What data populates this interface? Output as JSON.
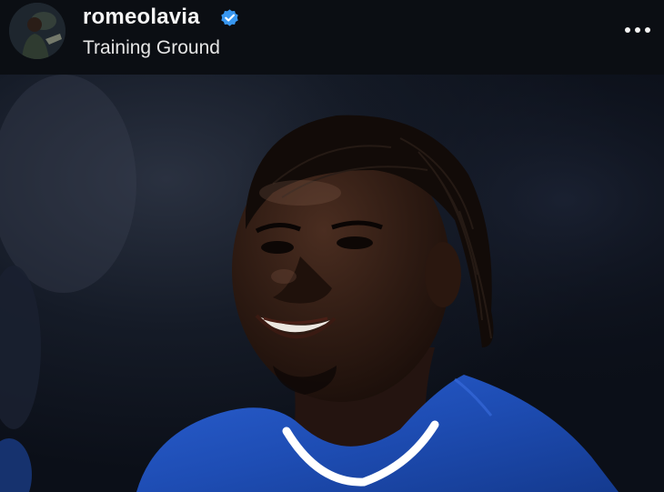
{
  "post": {
    "username": "romeolavia",
    "verified": true,
    "location": "Training Ground",
    "icons": {
      "avatar": "profile-photo",
      "verified": "verified-badge-icon",
      "more": "more-options-icon"
    },
    "colors": {
      "background": "#0a0d12",
      "verified_blue": "#3897f0",
      "jersey_blue": "#1f4fb8"
    }
  }
}
